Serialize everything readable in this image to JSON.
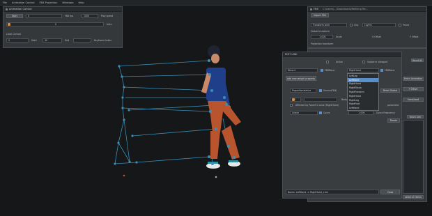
{
  "menubar": [
    "File",
    "Animation Control",
    "FBX Projection",
    "Windows",
    "Help"
  ],
  "anim_panel": {
    "title": "Animation Control",
    "play_label": "Start",
    "frame_value": "0",
    "fbx_fps_label": "FBX fps",
    "fps_value": "1000",
    "play_speed_label": "Play speed",
    "frame_slider_value": "0",
    "frame_slider_unit": "ticks",
    "section": "Local Control",
    "start_value": "0",
    "start_label": "Start",
    "end_value": "40",
    "end_label": "End",
    "keyframe_label": "Keyframe Index"
  },
  "fbx_panel": {
    "title": "FBX",
    "path": "C:/Users/.../Downloads/Walking Re...",
    "import_label": "Import FBX",
    "transform_label": "Transform Joint",
    "clip_label": "Clip",
    "layers_label": "Layers",
    "prune_label": "Prune",
    "section_transform": "Global transform",
    "scale_value": "1.000",
    "scale_label": "Scale",
    "x_offset_label": "X Offset",
    "y_offset_label": "Y Offset",
    "section_projection": "Projection transform",
    "reset_label": "Reset All",
    "find_label": "Find all",
    "rotate_label": "Rotate",
    "right_btn_1": "Fetch Animation",
    "right_btn_2": "Y Offset",
    "right_btn_3": "Save/Load",
    "quick_label": "Quick Link",
    "select_all_label": "select all items"
  },
  "edit_link": {
    "title": "EDIT LINK",
    "active_label": "Active",
    "visible_label": "Visible in viewport",
    "source_value": "Wrist.4",
    "fbx_bone_label": "FBXBone",
    "target_value": "RightHand",
    "fbx_bone_label_2": "FBXBone",
    "add_weight_label": "Add new weight property",
    "reset_label": "Reset",
    "prop_value": "Proportionalative",
    "source_fbx_label": "Source(FBX)",
    "reset_global_label": "Reset Global",
    "small_value": "-40",
    "body_part_label": "Bodytype",
    "parameter_label": "parameter",
    "affected_label": "Affected by Parent's value (RightHand)",
    "linear_value": "Linear",
    "curve_label": "Curve",
    "curve_value": "1.000",
    "curve_freq_label": "Curve Frequency",
    "delete_label": "Delete",
    "footer_text": "Bones: LeftHand -> RightHand, Link",
    "close_label": "Close",
    "dropdown_items": [
      "LeftLeg",
      "LeftHand",
      "RightHand",
      "RightElbow",
      "RightForearm",
      "RightHand",
      "RightLeg",
      "RightFoot",
      "LeftHand"
    ],
    "dropdown_selected": 1
  },
  "colors": {
    "accent": "#d08c3c",
    "selection": "#5b8fc9",
    "skeleton": "#3a8fb7"
  }
}
